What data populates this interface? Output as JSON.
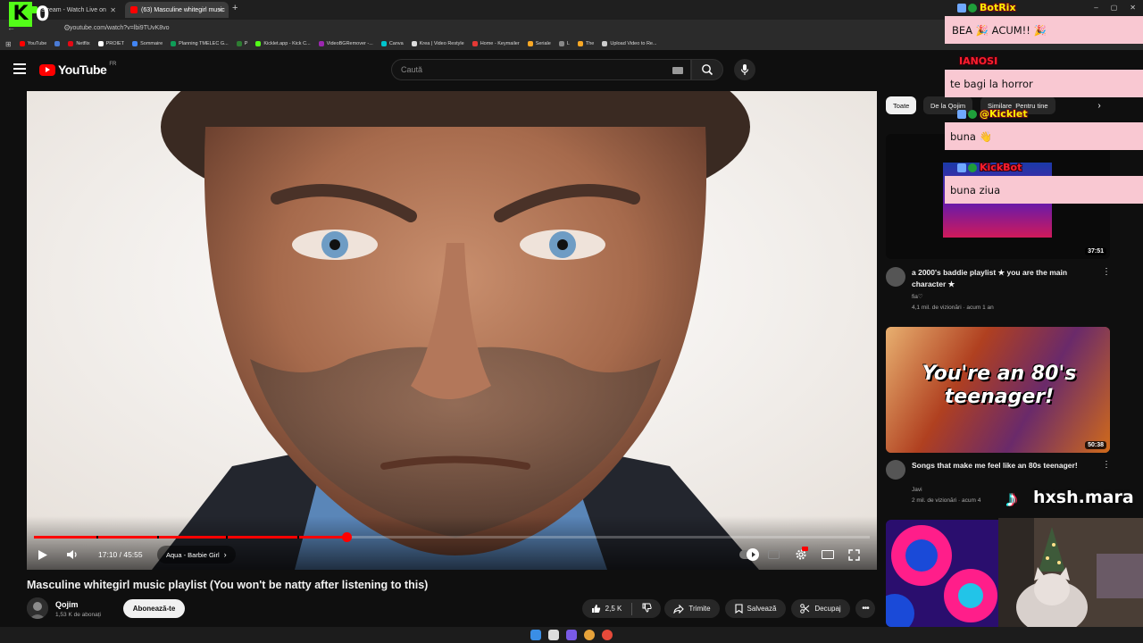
{
  "browser": {
    "tabs": [
      {
        "label": "Stream - Watch Live on",
        "active": false
      },
      {
        "label": "(63) Masculine whitegirl music",
        "active": true
      }
    ],
    "url": "youtube.com/watch?v=lbi9TUvK8vo",
    "bookmarks": [
      "YouTube",
      "Netflix",
      "PROIET",
      "Sommaire",
      "Planning TMELEC G...",
      "P",
      "Kicklet.app - Kick C...",
      "VideoBGRemover -...",
      "Canva",
      "Krea | Video Restyle",
      "Home - Keymailer",
      "Seriale",
      "L",
      "The",
      "Upload Video to Re..."
    ]
  },
  "stream_overlay": {
    "logo_letter": "K",
    "viewer_count": "0",
    "tiktok_handle": "hxsh.mara",
    "chat": [
      {
        "name": "BotRix",
        "message": "BEA 🎉 ACUM!! 🎉",
        "name_color": "#ffef00"
      },
      {
        "name": "IANOSI",
        "message": "te bagi la horror",
        "name_color": "#ff1e2e"
      },
      {
        "name": "@Kicklet",
        "message": "buna 👋",
        "name_color": "#ffef00"
      },
      {
        "name": "KickBot",
        "message": "buna ziua",
        "name_color": "#ff1e2e"
      }
    ]
  },
  "youtube": {
    "logo_text": "YouTube",
    "region": "FR",
    "search_placeholder": "Caută",
    "player": {
      "time": "17:10 / 45:55",
      "chapter": "Aqua - Barbie Girl",
      "progress": 0.374,
      "buffered": 0.38
    },
    "video_title": "Masculine whitegirl music playlist (You won't be natty after listening to this)",
    "channel": {
      "name": "Qojim",
      "subscribers": "1,53 K de abonați"
    },
    "subscribe_label": "Abonează-te",
    "actions": {
      "likes": "2,5 K",
      "share": "Trimite",
      "save": "Salvează",
      "clip": "Decupaj"
    },
    "chips": [
      "Toate",
      "De la Qojim",
      "Similare",
      "Pentru tine"
    ],
    "recommendations": [
      {
        "duration": "37:51",
        "title": "a 2000's baddie playlist ★ you are the main character ★",
        "channel": "fia♡",
        "meta": "4,1 mil. de vizionări · acum 1 an"
      },
      {
        "duration": "50:38",
        "thumb_text": "You're an 80's teenager!",
        "title": "Songs that make me feel like an 80s teenager!",
        "channel": "Javi",
        "meta": "2 mil. de vizionări · acum 4"
      },
      {
        "duration": "",
        "title": "",
        "channel": "",
        "meta": ""
      }
    ]
  },
  "colors": {
    "accent": "#ff0000",
    "chat_bg": "#f9c8d2",
    "kick_green": "#53fc18"
  }
}
